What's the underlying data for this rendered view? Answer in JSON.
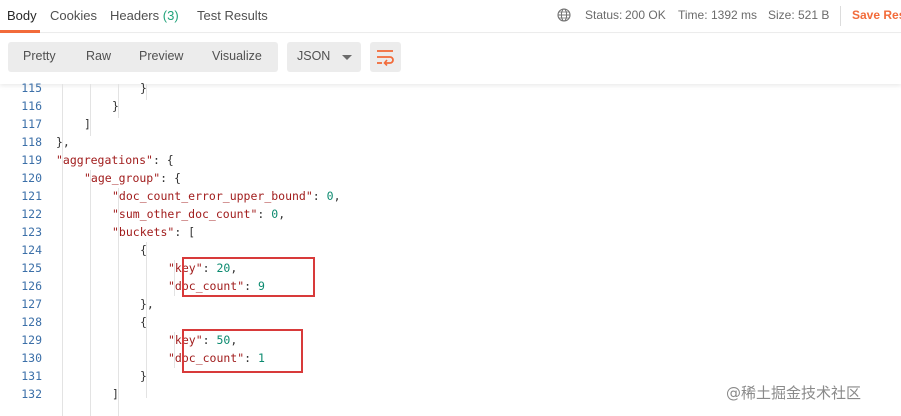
{
  "tabs": [
    {
      "label": "Body"
    },
    {
      "label": "Cookies"
    },
    {
      "label": "Headers",
      "count": "(3)"
    },
    {
      "label": "Test Results"
    }
  ],
  "status": {
    "status_label": "Status:",
    "status_value": "200 OK",
    "time_label": "Time:",
    "time_value": "1392 ms",
    "size_label": "Size:",
    "size_value": "521 B",
    "save_label": "Save Res"
  },
  "view_modes": [
    "Pretty",
    "Raw",
    "Preview",
    "Visualize"
  ],
  "format": {
    "selected": "JSON"
  },
  "icons": {
    "globe": "globe-icon",
    "wrap": "wrap-lines-icon",
    "caret": "chevron-down-icon"
  },
  "colors": {
    "accent": "#f26b3a",
    "ok": "#21a37a",
    "highlight_box": "#d83a3a",
    "key": "#a11d1d",
    "number": "#0b8a6f",
    "line_number": "#3b6fa8"
  },
  "code_lines": [
    {
      "n": "115",
      "parts": [
        {
          "t": "}",
          "c": "p"
        }
      ]
    },
    {
      "n": "116",
      "parts": [
        {
          "t": "}",
          "c": "p"
        }
      ]
    },
    {
      "n": "117",
      "parts": [
        {
          "t": "]",
          "c": "p"
        }
      ]
    },
    {
      "n": "118",
      "parts": [
        {
          "t": "},",
          "c": "p"
        }
      ]
    },
    {
      "n": "119",
      "parts": [
        {
          "t": "\"aggregations\"",
          "c": "k"
        },
        {
          "t": ": {",
          "c": "p"
        }
      ]
    },
    {
      "n": "120",
      "parts": [
        {
          "t": "\"age_group\"",
          "c": "k"
        },
        {
          "t": ": {",
          "c": "p"
        }
      ]
    },
    {
      "n": "121",
      "parts": [
        {
          "t": "\"doc_count_error_upper_bound\"",
          "c": "k"
        },
        {
          "t": ": ",
          "c": "p"
        },
        {
          "t": "0",
          "c": "n"
        },
        {
          "t": ",",
          "c": "p"
        }
      ]
    },
    {
      "n": "122",
      "parts": [
        {
          "t": "\"sum_other_doc_count\"",
          "c": "k"
        },
        {
          "t": ": ",
          "c": "p"
        },
        {
          "t": "0",
          "c": "n"
        },
        {
          "t": ",",
          "c": "p"
        }
      ]
    },
    {
      "n": "123",
      "parts": [
        {
          "t": "\"buckets\"",
          "c": "k"
        },
        {
          "t": ": [",
          "c": "p"
        }
      ]
    },
    {
      "n": "124",
      "parts": [
        {
          "t": "{",
          "c": "p"
        }
      ]
    },
    {
      "n": "125",
      "parts": [
        {
          "t": "\"key\"",
          "c": "k"
        },
        {
          "t": ": ",
          "c": "p"
        },
        {
          "t": "20",
          "c": "n"
        },
        {
          "t": ",",
          "c": "p"
        }
      ]
    },
    {
      "n": "126",
      "parts": [
        {
          "t": "\"doc_count\"",
          "c": "k"
        },
        {
          "t": ": ",
          "c": "p"
        },
        {
          "t": "9",
          "c": "n"
        }
      ]
    },
    {
      "n": "127",
      "parts": [
        {
          "t": "},",
          "c": "p"
        }
      ]
    },
    {
      "n": "128",
      "parts": [
        {
          "t": "{",
          "c": "p"
        }
      ]
    },
    {
      "n": "129",
      "parts": [
        {
          "t": "\"key\"",
          "c": "k"
        },
        {
          "t": ": ",
          "c": "p"
        },
        {
          "t": "50",
          "c": "n"
        },
        {
          "t": ",",
          "c": "p"
        }
      ]
    },
    {
      "n": "130",
      "parts": [
        {
          "t": "\"doc_count\"",
          "c": "k"
        },
        {
          "t": ": ",
          "c": "p"
        },
        {
          "t": "1",
          "c": "n"
        }
      ]
    },
    {
      "n": "131",
      "parts": [
        {
          "t": "}",
          "c": "p"
        }
      ]
    },
    {
      "n": "132",
      "parts": [
        {
          "t": "]",
          "c": "p"
        }
      ]
    }
  ],
  "watermark": "@稀土掘金技术社区"
}
